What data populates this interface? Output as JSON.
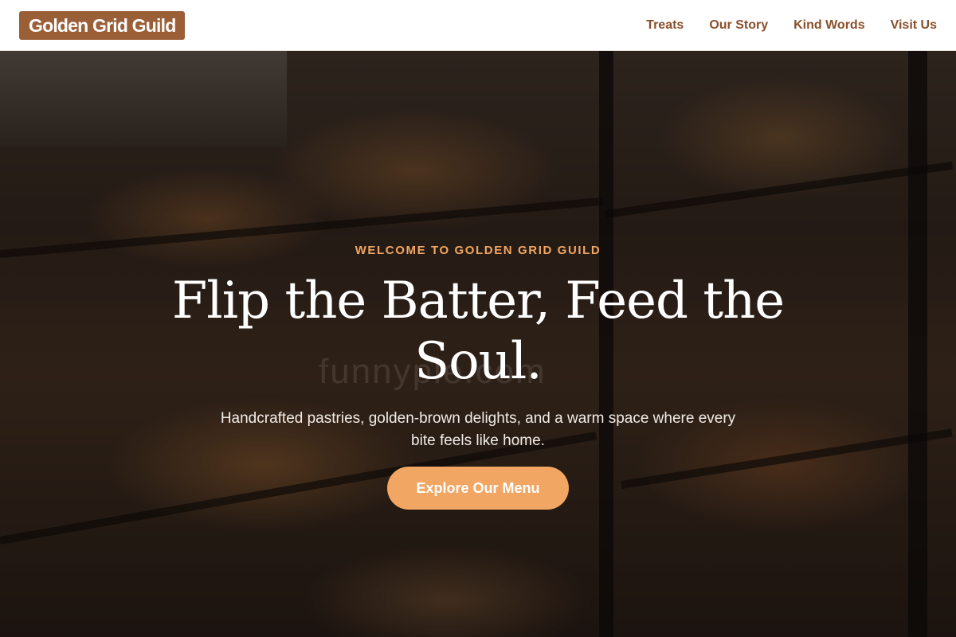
{
  "header": {
    "logo_text": "Golden Grid Guild",
    "nav": [
      {
        "label": "Treats"
      },
      {
        "label": "Our Story"
      },
      {
        "label": "Kind Words"
      },
      {
        "label": "Visit Us"
      }
    ]
  },
  "hero": {
    "eyebrow": "WELCOME TO GOLDEN GRID GUILD",
    "title": "Flip the Batter, Feed the Soul.",
    "subtitle": "Handcrafted pastries, golden-brown delights, and a warm space where every bite feels like home.",
    "cta_label": "Explore Our Menu",
    "watermark": "funnyple.com"
  },
  "colors": {
    "brand": "#9b5f38",
    "nav_text": "#8a4f2a",
    "accent": "#f2a663"
  }
}
